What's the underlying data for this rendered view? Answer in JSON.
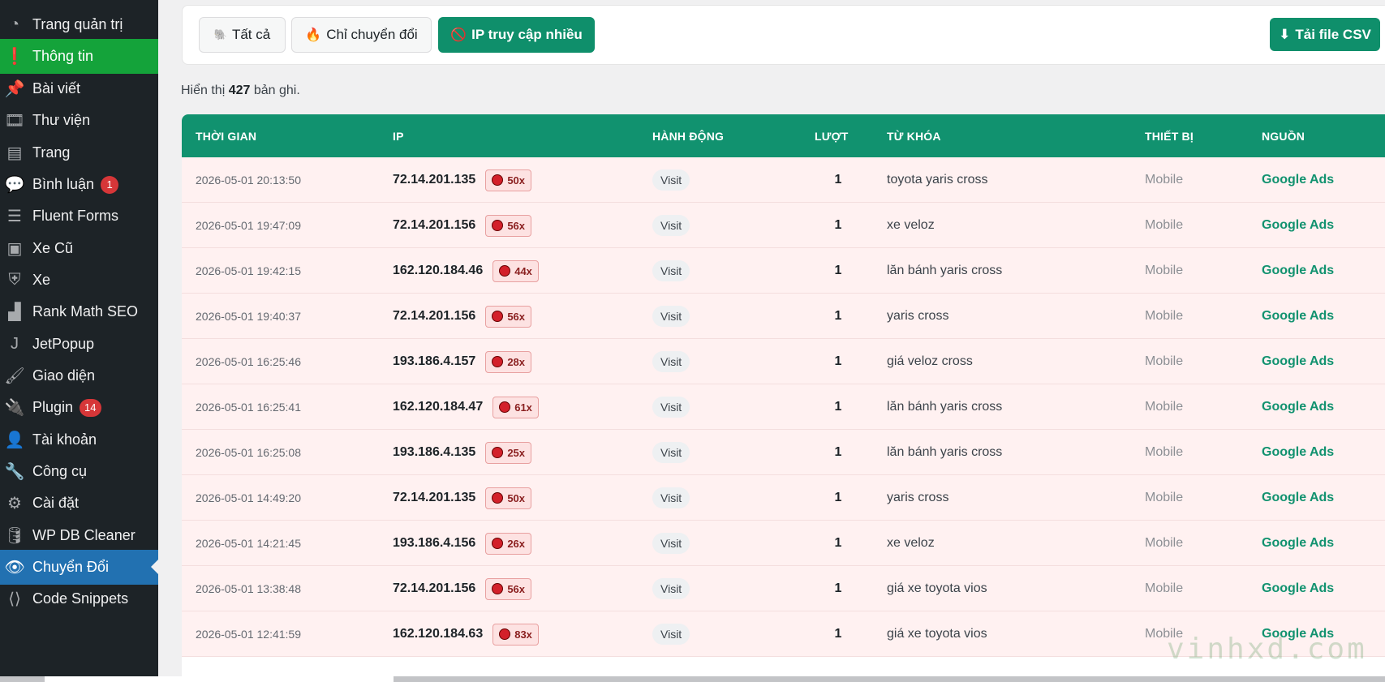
{
  "sidebar": {
    "items": [
      {
        "label": "Trang quản trị",
        "icon": "dashboard-icon",
        "glyph": "◔"
      },
      {
        "label": "Thông tin",
        "icon": "info-icon",
        "glyph": "❗",
        "active": "green"
      },
      {
        "label": "Bài viết",
        "icon": "pin-icon",
        "glyph": "📌"
      },
      {
        "label": "Thư viện",
        "icon": "media-icon",
        "glyph": "🎞"
      },
      {
        "label": "Trang",
        "icon": "pages-icon",
        "glyph": "▤"
      },
      {
        "label": "Bình luận",
        "icon": "comments-icon",
        "glyph": "💬",
        "badge": "1"
      },
      {
        "label": "Fluent Forms",
        "icon": "forms-icon",
        "glyph": "☰"
      },
      {
        "label": "Xe Cũ",
        "icon": "chart-icon",
        "glyph": "▣"
      },
      {
        "label": "Xe",
        "icon": "shield-icon",
        "glyph": "⛨"
      },
      {
        "label": "Rank Math SEO",
        "icon": "rankmath-icon",
        "glyph": "▟"
      },
      {
        "label": "JetPopup",
        "icon": "jet-icon",
        "glyph": "J"
      },
      {
        "label": "Giao diện",
        "icon": "brush-icon",
        "glyph": "🖌"
      },
      {
        "label": "Plugin",
        "icon": "plugin-icon",
        "glyph": "🔌",
        "badge": "14"
      },
      {
        "label": "Tài khoản",
        "icon": "user-icon",
        "glyph": "👤"
      },
      {
        "label": "Công cụ",
        "icon": "wrench-icon",
        "glyph": "🔧"
      },
      {
        "label": "Cài đặt",
        "icon": "settings-icon",
        "glyph": "⚙"
      },
      {
        "label": "WP DB Cleaner",
        "icon": "database-icon",
        "glyph": "🛢"
      },
      {
        "label": "Chuyển Đổi",
        "icon": "eye-icon",
        "glyph": "👁",
        "active": "blue"
      },
      {
        "label": "Code Snippets",
        "icon": "code-icon",
        "glyph": "⟨⟩"
      }
    ]
  },
  "filters": {
    "all_label": "Tất cả",
    "all_icon": "🐘",
    "conversions_label": "Chỉ chuyển đổi",
    "conversions_icon": "🔥",
    "frequent_ip_label": "IP truy cập nhiều",
    "frequent_ip_icon": "🚫",
    "csv_label": "Tải file CSV",
    "csv_icon": "⬇"
  },
  "summary": {
    "prefix": "Hiển thị",
    "count": "427",
    "suffix": "bản ghi."
  },
  "table": {
    "headers": {
      "time": "THỜI GIAN",
      "ip": "IP",
      "action": "HÀNH ĐỘNG",
      "count": "LƯỢT",
      "keyword": "TỪ KHÓA",
      "device": "THIẾT BỊ",
      "source": "NGUỒN"
    },
    "rows": [
      {
        "time": "2026-05-01 20:13:50",
        "ip": "72.14.201.135",
        "hits": "50x",
        "action": "Visit",
        "count": "1",
        "keyword": "toyota yaris cross",
        "device": "Mobile",
        "source": "Google Ads"
      },
      {
        "time": "2026-05-01 19:47:09",
        "ip": "72.14.201.156",
        "hits": "56x",
        "action": "Visit",
        "count": "1",
        "keyword": "xe veloz",
        "device": "Mobile",
        "source": "Google Ads"
      },
      {
        "time": "2026-05-01 19:42:15",
        "ip": "162.120.184.46",
        "hits": "44x",
        "action": "Visit",
        "count": "1",
        "keyword": "lăn bánh yaris cross",
        "device": "Mobile",
        "source": "Google Ads"
      },
      {
        "time": "2026-05-01 19:40:37",
        "ip": "72.14.201.156",
        "hits": "56x",
        "action": "Visit",
        "count": "1",
        "keyword": "yaris cross",
        "device": "Mobile",
        "source": "Google Ads"
      },
      {
        "time": "2026-05-01 16:25:46",
        "ip": "193.186.4.157",
        "hits": "28x",
        "action": "Visit",
        "count": "1",
        "keyword": "giá veloz cross",
        "device": "Mobile",
        "source": "Google Ads"
      },
      {
        "time": "2026-05-01 16:25:41",
        "ip": "162.120.184.47",
        "hits": "61x",
        "action": "Visit",
        "count": "1",
        "keyword": "lăn bánh yaris cross",
        "device": "Mobile",
        "source": "Google Ads"
      },
      {
        "time": "2026-05-01 16:25:08",
        "ip": "193.186.4.135",
        "hits": "25x",
        "action": "Visit",
        "count": "1",
        "keyword": "lăn bánh yaris cross",
        "device": "Mobile",
        "source": "Google Ads"
      },
      {
        "time": "2026-05-01 14:49:20",
        "ip": "72.14.201.135",
        "hits": "50x",
        "action": "Visit",
        "count": "1",
        "keyword": "yaris cross",
        "device": "Mobile",
        "source": "Google Ads"
      },
      {
        "time": "2026-05-01 14:21:45",
        "ip": "193.186.4.156",
        "hits": "26x",
        "action": "Visit",
        "count": "1",
        "keyword": "xe veloz",
        "device": "Mobile",
        "source": "Google Ads"
      },
      {
        "time": "2026-05-01 13:38:48",
        "ip": "72.14.201.156",
        "hits": "56x",
        "action": "Visit",
        "count": "1",
        "keyword": "giá xe toyota vios",
        "device": "Mobile",
        "source": "Google Ads"
      },
      {
        "time": "2026-05-01 12:41:59",
        "ip": "162.120.184.63",
        "hits": "83x",
        "action": "Visit",
        "count": "1",
        "keyword": "giá xe toyota vios",
        "device": "Mobile",
        "source": "Google Ads"
      }
    ]
  },
  "watermark": "vinhxd.com",
  "colors": {
    "accent": "#11926f",
    "sidebar_bg": "#1d2327",
    "active_green": "#14a33a",
    "active_blue": "#2271b1",
    "row_bg": "#fff1f1",
    "badge_red": "#d63638"
  }
}
